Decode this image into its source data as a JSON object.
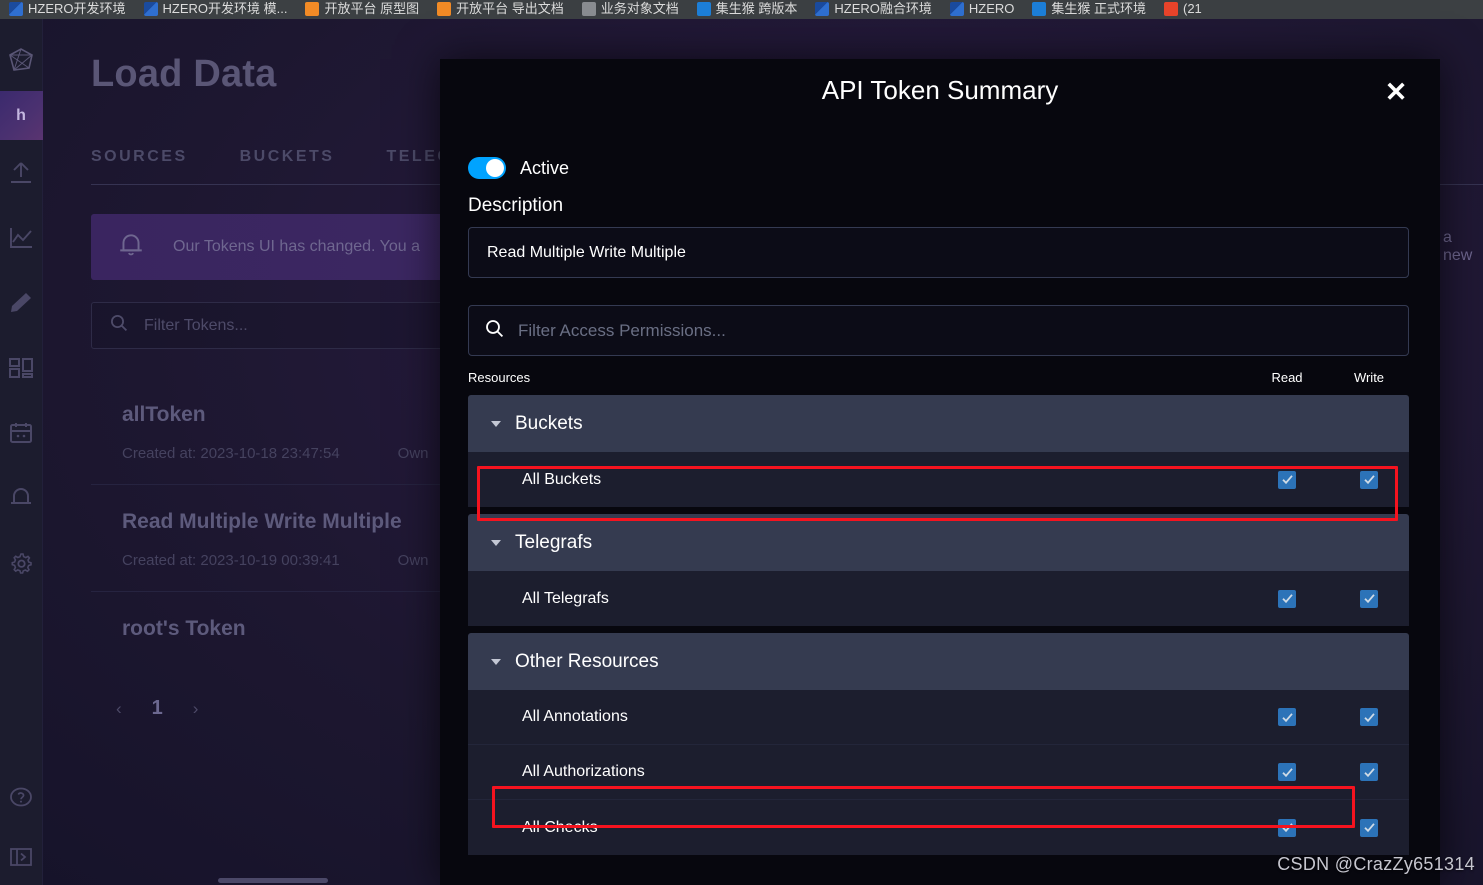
{
  "browser": {
    "bookmarks": [
      {
        "label": "HZERO开发环境",
        "icon": "site-icon-blue",
        "color": "#2f6fd0"
      },
      {
        "label": "HZERO开发环境 模...",
        "icon": "site-icon-blue",
        "color": "#2f6fd0"
      },
      {
        "label": "开放平台 原型图",
        "icon": "site-icon-orange",
        "color": "#f28b26"
      },
      {
        "label": "开放平台 导出文档",
        "icon": "site-icon-orange",
        "color": "#f28b26"
      },
      {
        "label": "业务对象文档",
        "icon": "site-icon-grey",
        "color": "#8a8d91"
      },
      {
        "label": "集生猴 跨版本",
        "icon": "site-icon-cyan",
        "color": "#1d7fd8"
      },
      {
        "label": "HZERO融合环境",
        "icon": "site-icon-blue",
        "color": "#2f6fd0"
      },
      {
        "label": "HZERO",
        "icon": "site-icon-blue",
        "color": "#2f6fd0"
      },
      {
        "label": "集生猴 正式环境",
        "icon": "site-icon-cyan",
        "color": "#1d7fd8"
      },
      {
        "label": "(21",
        "icon": "site-icon-red",
        "color": "#e8442b"
      }
    ]
  },
  "sidebar": {
    "org_initial": "h",
    "items": [
      {
        "name": "influxdb-logo",
        "icon": "influx-logo-icon"
      },
      {
        "name": "organization",
        "icon": "org-avatar-icon"
      },
      {
        "name": "load-data",
        "icon": "upload-icon"
      },
      {
        "name": "data-explorer",
        "icon": "line-graph-icon"
      },
      {
        "name": "notebooks",
        "icon": "pencil-icon"
      },
      {
        "name": "dashboards",
        "icon": "dashboard-grid-icon"
      },
      {
        "name": "tasks",
        "icon": "calendar-icon"
      },
      {
        "name": "alerts",
        "icon": "bell-icon"
      },
      {
        "name": "settings",
        "icon": "gear-icon"
      },
      {
        "name": "help",
        "icon": "question-circle-icon"
      },
      {
        "name": "collapse-nav",
        "icon": "panel-collapse-icon"
      }
    ]
  },
  "page": {
    "title": "Load Data",
    "tabs": [
      {
        "label": "SOURCES"
      },
      {
        "label": "BUCKETS"
      },
      {
        "label": "TELEGRAFS"
      }
    ],
    "banner": {
      "icon": "bell-icon",
      "text": "Our Tokens UI has changed. You a",
      "text_right_fragment": "a new"
    },
    "filter": {
      "icon": "search-icon",
      "placeholder": "Filter Tokens..."
    },
    "tokens": [
      {
        "name": "allToken",
        "created_label": "Created at: 2023-10-18 23:47:54",
        "owner_label": "Own"
      },
      {
        "name": "Read Multiple Write Multiple",
        "created_label": "Created at: 2023-10-19 00:39:41",
        "owner_label": "Own"
      },
      {
        "name": "root's Token",
        "created_label": "",
        "owner_label": ""
      }
    ],
    "pagination": {
      "prev": "‹",
      "page": "1",
      "next": "›"
    }
  },
  "modal": {
    "title": "API Token Summary",
    "close_label": "✕",
    "active_toggle": {
      "label": "Active",
      "on": true,
      "color": "#00a3ff"
    },
    "description_label": "Description",
    "description_value": "Read Multiple Write Multiple",
    "permission_filter": {
      "icon": "search-icon",
      "placeholder": "Filter Access Permissions..."
    },
    "columns": {
      "resources": "Resources",
      "read": "Read",
      "write": "Write"
    },
    "sections": [
      {
        "title": "Buckets",
        "expanded": true,
        "rows": [
          {
            "name": "All Buckets",
            "read": true,
            "write": true,
            "highlighted": true
          }
        ]
      },
      {
        "title": "Telegrafs",
        "expanded": true,
        "rows": [
          {
            "name": "All Telegrafs",
            "read": true,
            "write": true,
            "highlighted": false
          }
        ]
      },
      {
        "title": "Other Resources",
        "expanded": true,
        "rows": [
          {
            "name": "All Annotations",
            "read": true,
            "write": true,
            "highlighted": false
          },
          {
            "name": "All Authorizations",
            "read": true,
            "write": true,
            "highlighted": true
          },
          {
            "name": "All Checks",
            "read": true,
            "write": true,
            "highlighted": false
          }
        ]
      }
    ]
  },
  "annotations": {
    "highlight_color": "#f5131f",
    "boxes": [
      {
        "target": "All Buckets"
      },
      {
        "target": "All Authorizations"
      }
    ]
  },
  "watermark": "CSDN @CrazZy651314",
  "colors": {
    "accent_blue": "#00a3ff",
    "checkbox_blue": "#2c73b8",
    "modal_bg": "#07070e",
    "section_header": "#353b50",
    "row_bg": "#1c1e2e",
    "highlight_red": "#f5131f"
  }
}
